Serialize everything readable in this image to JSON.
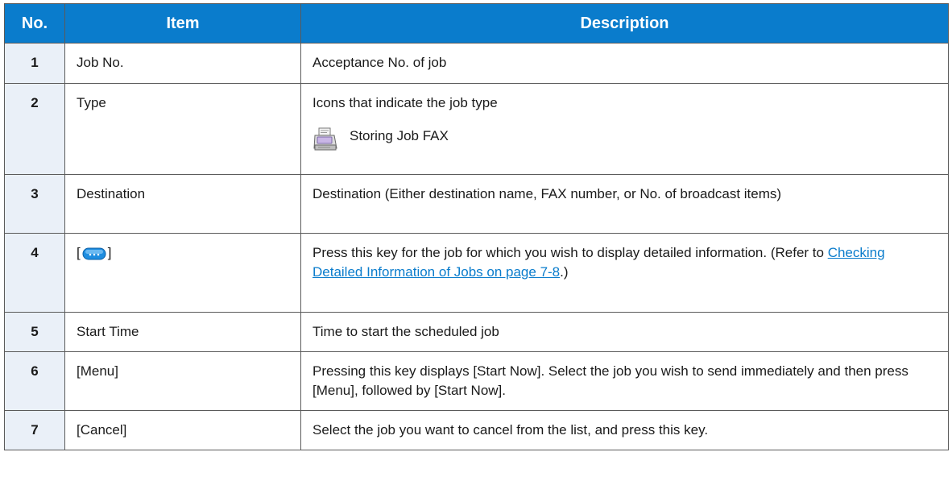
{
  "table": {
    "headers": {
      "no": "No.",
      "item": "Item",
      "description": "Description"
    },
    "rows": [
      {
        "no": "1",
        "item": "Job No.",
        "description": "Acceptance No. of job"
      },
      {
        "no": "2",
        "item": "Type",
        "description": "Icons that indicate the job type",
        "icon_label": "Storing Job FAX",
        "icon": "fax-machine-icon"
      },
      {
        "no": "3",
        "item": "Destination",
        "description": "Destination (Either destination name, FAX number, or No. of broadcast items)"
      },
      {
        "no": "4",
        "item_prefix": "[",
        "item_suffix": "]",
        "item_icon": "ellipsis-key-icon",
        "description_prefix": "Press this key for the job for which you wish to display detailed information. (Refer to ",
        "description_link": "Checking Detailed Information of Jobs on page 7-8",
        "description_suffix": ".)"
      },
      {
        "no": "5",
        "item": "Start Time",
        "description": "Time to start the scheduled job"
      },
      {
        "no": "6",
        "item": "[Menu]",
        "description": "Pressing this key displays [Start Now]. Select the job you wish to send immediately and then press [Menu], followed by [Start Now]."
      },
      {
        "no": "7",
        "item": "[Cancel]",
        "description": "Select the job you want to cancel from the list, and press this key."
      }
    ]
  },
  "colors": {
    "header_bg": "#0a7ccc",
    "number_cell_bg": "#eaf0f8",
    "link": "#0a7ccc"
  }
}
